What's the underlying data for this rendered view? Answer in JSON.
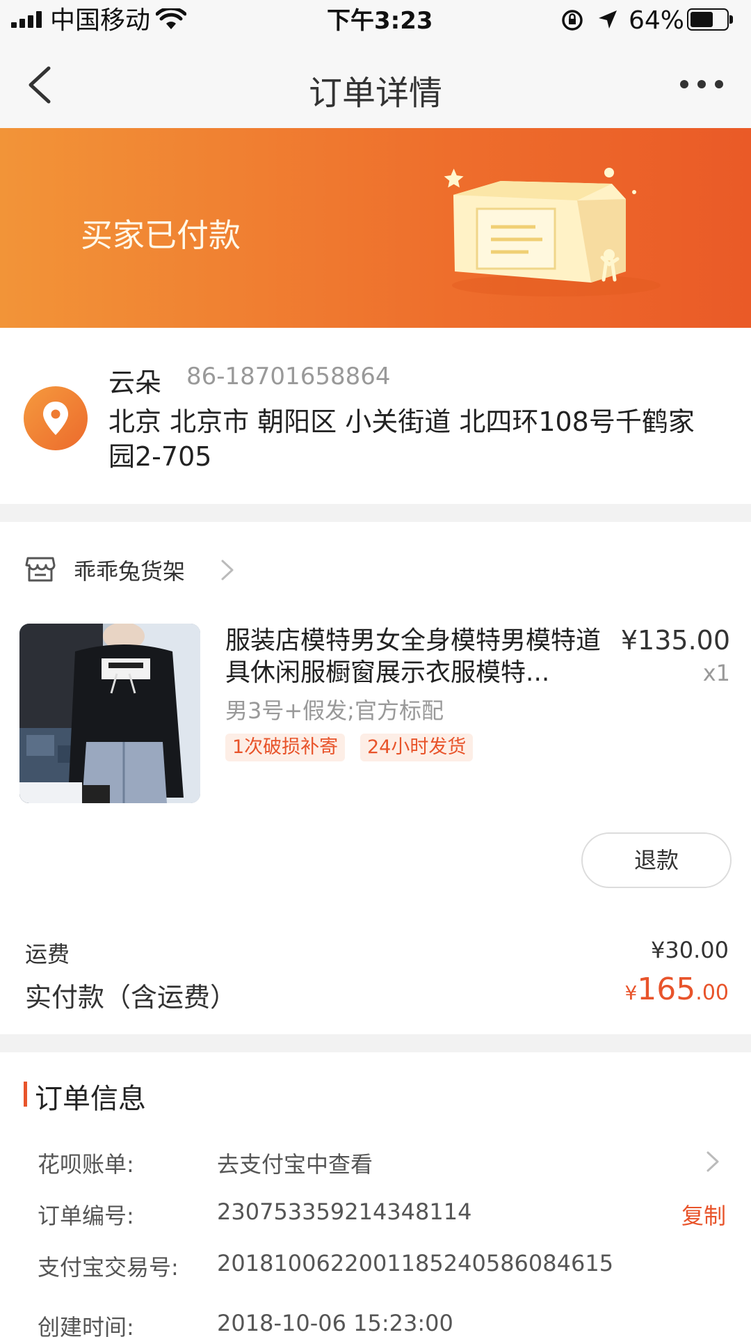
{
  "status_bar": {
    "carrier": "中国移动",
    "time": "下午3:23",
    "battery": "64%",
    "battery_level": 0.64
  },
  "navbar": {
    "title": "订单详情",
    "back_icon": "chevron-left-icon",
    "more_icon": "more-dots-icon"
  },
  "banner": {
    "status_text": "买家已付款",
    "colors": {
      "start": "#f29438",
      "end": "#ea5a27"
    }
  },
  "address": {
    "name": "云朵",
    "phone": "86-18701658864",
    "full_address": "北京 北京市 朝阳区 小关街道 北四环108号千鹤家园2-705",
    "icon": "location-pin-icon"
  },
  "shop": {
    "name": "乖乖兔货架",
    "icon": "store-icon"
  },
  "product": {
    "title": "服装店模特男女全身模特男模特道具休闲服橱窗展示衣服模特...",
    "price": "¥135.00",
    "quantity": "x1",
    "spec": "男3号+假发;官方标配",
    "tags": [
      "1次破损补寄",
      "24小时发货"
    ]
  },
  "actions": {
    "refund_label": "退款"
  },
  "summary": {
    "shipping_label": "运费",
    "shipping_value": "¥30.00",
    "paid_label": "实付款（含运费）",
    "paid_currency": "¥",
    "paid_integer": "165",
    "paid_decimal": ".00"
  },
  "order_info": {
    "title": "订单信息",
    "rows": [
      {
        "label": "花呗账单:",
        "value": "去支付宝中查看"
      },
      {
        "label": "订单编号:",
        "value": "230753359214348114",
        "action": "复制"
      },
      {
        "label": "支付宝交易号:",
        "value": "2018100622001185240586084615"
      },
      {
        "label": "创建时间:",
        "value": "2018-10-06 15:23:00"
      }
    ]
  },
  "colors": {
    "accent": "#e8542b",
    "banner_orange": "#ee6e2c"
  }
}
